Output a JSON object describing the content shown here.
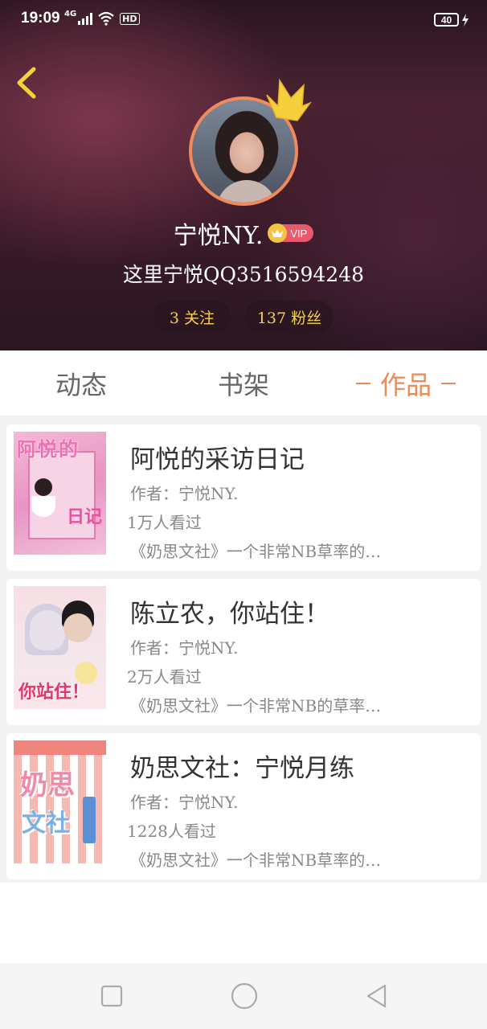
{
  "status_bar": {
    "time": "19:09",
    "network": "4G",
    "hd": "HD",
    "battery": "40"
  },
  "profile": {
    "nickname": "宁悦NY.",
    "vip_label": "VIP",
    "signature": "这里宁悦QQ3516594248",
    "follow_count": "3 关注",
    "fans_count": "137 粉丝"
  },
  "tabs": [
    {
      "label": "动态"
    },
    {
      "label": "书架"
    },
    {
      "label": "作品"
    }
  ],
  "books": [
    {
      "title": "阿悦的采访日记",
      "author": "作者：宁悦NY.",
      "views": "1万人看过",
      "desc": "《奶思文社》一个非常NB草率的…",
      "cover_text": "阿悦的",
      "cover_text2": "日记"
    },
    {
      "title": "陈立农，你站住！",
      "author": "作者：宁悦NY.",
      "views": "2万人看过",
      "desc": "《奶思文社》一个非常NB的草率…",
      "cover_text": "你站住！"
    },
    {
      "title": "奶思文社：宁悦月练",
      "author": "作者：宁悦NY.",
      "views": "1228人看过",
      "desc": "《奶思文社》一个非常NB草率的…",
      "cover_text": "奶思",
      "cover_text2": "文社"
    }
  ],
  "colors": {
    "accent": "#ee8a55",
    "fans_text": "#f6d14a",
    "vip": "#e8596b"
  },
  "icons": {
    "back": "chevron-left-icon",
    "crown": "crown-icon",
    "nav_recent": "square-icon",
    "nav_home": "circle-icon",
    "nav_back": "triangle-left-icon"
  }
}
